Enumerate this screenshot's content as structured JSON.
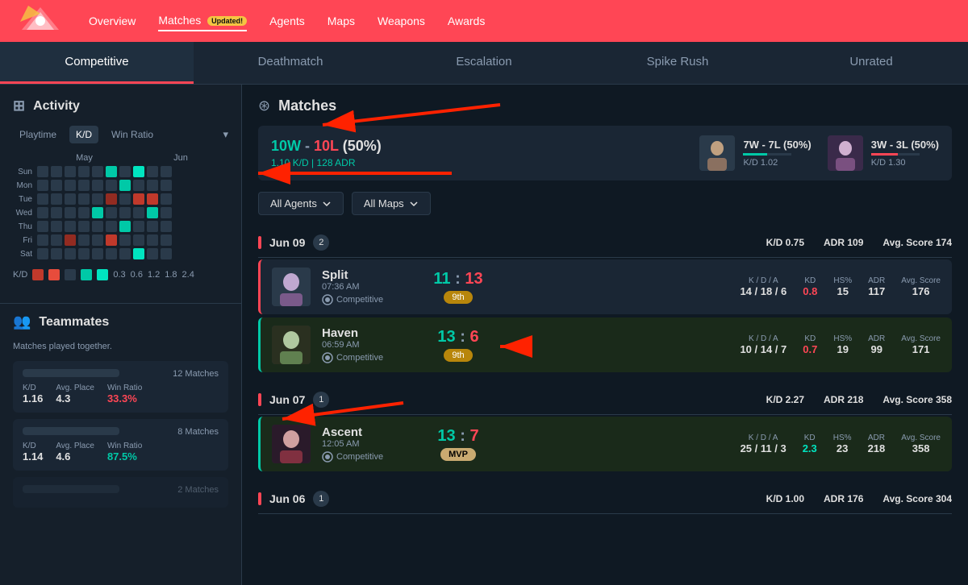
{
  "nav": {
    "links": [
      {
        "label": "Overview",
        "active": false
      },
      {
        "label": "Matches",
        "active": true,
        "badge": "Updated!"
      },
      {
        "label": "Agents",
        "active": false
      },
      {
        "label": "Maps",
        "active": false
      },
      {
        "label": "Weapons",
        "active": false
      },
      {
        "label": "Awards",
        "active": false
      }
    ]
  },
  "mode_tabs": [
    {
      "label": "Competitive",
      "active": true
    },
    {
      "label": "Deathmatch",
      "active": false
    },
    {
      "label": "Escalation",
      "active": false
    },
    {
      "label": "Spike Rush",
      "active": false
    },
    {
      "label": "Unrated",
      "active": false
    }
  ],
  "activity": {
    "title": "Activity",
    "controls": [
      {
        "label": "Playtime",
        "active": false
      },
      {
        "label": "K/D",
        "active": true
      },
      {
        "label": "Win Ratio",
        "active": false
      }
    ],
    "months": [
      "May",
      "Jun"
    ],
    "days": [
      "Sun",
      "Mon",
      "Tue",
      "Wed",
      "Thu",
      "Fri",
      "Sat"
    ],
    "kd_legend": {
      "label": "K/D",
      "values": [
        "0.3",
        "0.6",
        "1.2",
        "1.8",
        "2.4"
      ]
    }
  },
  "teammates": {
    "title": "Teammates",
    "subtitle": "Matches played together.",
    "items": [
      {
        "matches": "12 Matches",
        "kd": "1.16",
        "avg_place": "4.3",
        "win_ratio": "33.3%",
        "win_ratio_color": "red"
      },
      {
        "matches": "8 Matches",
        "kd": "1.14",
        "avg_place": "4.6",
        "win_ratio": "87.5%",
        "win_ratio_color": "green"
      }
    ]
  },
  "matches": {
    "title": "Matches",
    "summary": {
      "wl": "10W - 10L (50%)",
      "w": "10W",
      "l": "10L",
      "pct": "(50%)",
      "kd_adr": "1.10 K/D | 128 ADR",
      "agents": [
        {
          "wl": "7W - 7L (50%)",
          "kd": "K/D 1.02",
          "bar_pct": 50,
          "bar_color": "#00c9a7"
        },
        {
          "wl": "3W - 3L (50%)",
          "kd": "K/D 1.30",
          "bar_pct": 55,
          "bar_color": "#ff4655"
        }
      ]
    },
    "filters": {
      "agents": "All Agents",
      "maps": "All Maps"
    },
    "day_groups": [
      {
        "date": "Jun 09",
        "count": 2,
        "kd": "0.75",
        "adr": "109",
        "avg_score": "174",
        "matches": [
          {
            "map": "Split",
            "time": "07:36 AM",
            "mode": "Competitive",
            "score_a": "11",
            "score_b": "13",
            "result": "loss",
            "rank": "9th",
            "kda": "14 / 18 / 6",
            "kd": "0.8",
            "kd_color": "red",
            "hs": "15",
            "adr": "117",
            "avg_score": "176"
          },
          {
            "map": "Haven",
            "time": "06:59 AM",
            "mode": "Competitive",
            "score_a": "13",
            "score_b": "6",
            "result": "win",
            "rank": "9th",
            "kda": "10 / 14 / 7",
            "kd": "0.7",
            "kd_color": "red",
            "hs": "19",
            "adr": "99",
            "avg_score": "171"
          }
        ]
      },
      {
        "date": "Jun 07",
        "count": 1,
        "kd": "2.27",
        "adr": "218",
        "avg_score": "358",
        "matches": [
          {
            "map": "Ascent",
            "time": "12:05 AM",
            "mode": "Competitive",
            "score_a": "13",
            "score_b": "7",
            "result": "win",
            "rank": "MVP",
            "kda": "25 / 11 / 3",
            "kd": "2.3",
            "kd_color": "teal",
            "hs": "23",
            "adr": "218",
            "avg_score": "358"
          }
        ]
      },
      {
        "date": "Jun 06",
        "count": 1,
        "kd": "1.00",
        "adr": "176",
        "avg_score": "304",
        "matches": []
      }
    ]
  }
}
